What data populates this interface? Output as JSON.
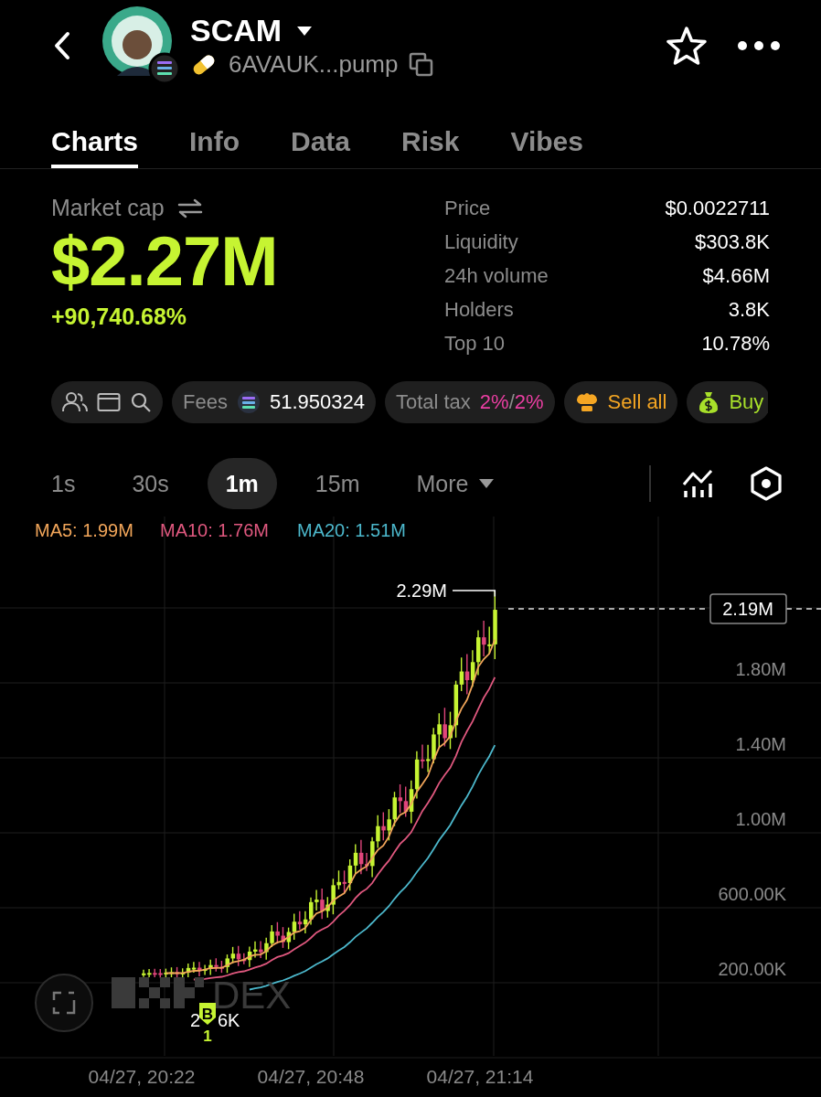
{
  "header": {
    "token_name": "SCAM",
    "address": "6AVAUK...pump"
  },
  "tabs": [
    {
      "label": "Charts",
      "selected": true
    },
    {
      "label": "Info",
      "selected": false
    },
    {
      "label": "Data",
      "selected": false
    },
    {
      "label": "Risk",
      "selected": false
    },
    {
      "label": "Vibes",
      "selected": false
    }
  ],
  "market_cap": {
    "label": "Market cap",
    "value": "$2.27M",
    "change": "+90,740.68%"
  },
  "stats": [
    {
      "label": "Price",
      "value": "$0.0022711"
    },
    {
      "label": "Liquidity",
      "value": "$303.8K"
    },
    {
      "label": "24h volume",
      "value": "$4.66M"
    },
    {
      "label": "Holders",
      "value": "3.8K"
    },
    {
      "label": "Top 10",
      "value": "10.78%"
    }
  ],
  "chips": {
    "fees_label": "Fees",
    "fees_value": "51.950324",
    "tax_label": "Total tax",
    "buy_tax": "2%",
    "separator": "/",
    "sell_tax": "2%",
    "sell_all": "Sell all",
    "buy": "Buy"
  },
  "timeframes": [
    {
      "label": "1s",
      "selected": false
    },
    {
      "label": "30s",
      "selected": false
    },
    {
      "label": "1m",
      "selected": true
    },
    {
      "label": "15m",
      "selected": false
    }
  ],
  "more": "More",
  "chart": {
    "ma_legend": [
      {
        "text": "MA5: 1.99M",
        "color": "#f2a65a"
      },
      {
        "text": "MA10: 1.76M",
        "color": "#e0587f"
      },
      {
        "text": "MA20: 1.51M",
        "color": "#4cb8cc"
      }
    ],
    "high_label": "2.29M",
    "price_label": "2.19M",
    "y_ticks": [
      "1.80M",
      "1.40M",
      "1.00M",
      "600.00K",
      "200.00K"
    ],
    "x_ticks": [
      "04/27, 20:22",
      "04/27, 20:48",
      "04/27, 21:14"
    ],
    "low_label_start": "2",
    "low_label_end": "6K",
    "marker": "B",
    "marker_count": "1",
    "watermark": "DEX"
  }
}
